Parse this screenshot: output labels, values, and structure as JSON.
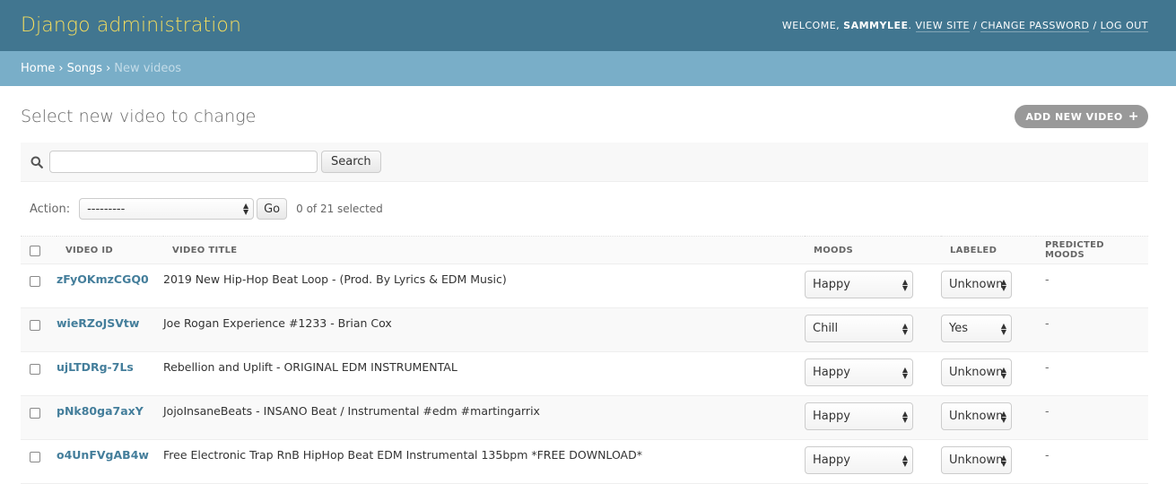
{
  "header": {
    "site_name": "Django administration",
    "welcome": "Welcome,",
    "username": "sammylee",
    "view_site": "View site",
    "change_password": "Change password",
    "log_out": "Log out",
    "sep": " / "
  },
  "breadcrumbs": {
    "home": "Home",
    "app": "Songs",
    "current": "New videos",
    "sep": "›"
  },
  "page": {
    "title": "Select new video to change",
    "add_button": "Add new video",
    "add_icon": "+"
  },
  "search": {
    "value": "",
    "placeholder": "",
    "button": "Search",
    "icon": "search-icon"
  },
  "actions": {
    "label": "Action:",
    "selected": "---------",
    "go": "Go",
    "counter": "0 of 21 selected"
  },
  "table": {
    "headers": {
      "video_id": "Video ID",
      "video_title": "Video title",
      "moods": "Moods",
      "labeled": "Labeled",
      "predicted_moods": "Predicted moods"
    },
    "rows": [
      {
        "id": "zFyOKmzCGQ0",
        "title": "2019 New Hip-Hop Beat Loop - (Prod. By Lyrics & EDM Music)",
        "mood": "Happy",
        "labeled": "Unknown",
        "predicted": "-"
      },
      {
        "id": "wieRZoJSVtw",
        "title": "Joe Rogan Experience #1233 - Brian Cox",
        "mood": "Chill",
        "labeled": "Yes",
        "predicted": "-"
      },
      {
        "id": "ujLTDRg-7Ls",
        "title": "Rebellion and Uplift - ORIGINAL EDM INSTRUMENTAL",
        "mood": "Happy",
        "labeled": "Unknown",
        "predicted": "-"
      },
      {
        "id": "pNk80ga7axY",
        "title": "JojoInsaneBeats - INSANO Beat / Instrumental #edm #martingarrix",
        "mood": "Happy",
        "labeled": "Unknown",
        "predicted": "-"
      },
      {
        "id": "o4UnFVgAB4w",
        "title": "Free Electronic Trap RnB HipHop Beat EDM Instrumental 135bpm *FREE DOWNLOAD*",
        "mood": "Happy",
        "labeled": "Unknown",
        "predicted": "-"
      }
    ]
  },
  "colors": {
    "header_bg": "#417690",
    "branding": "#f5dd5d",
    "breadcrumb_bg": "#79aec8",
    "link": "#447e9b",
    "add_button_bg": "#999999"
  }
}
